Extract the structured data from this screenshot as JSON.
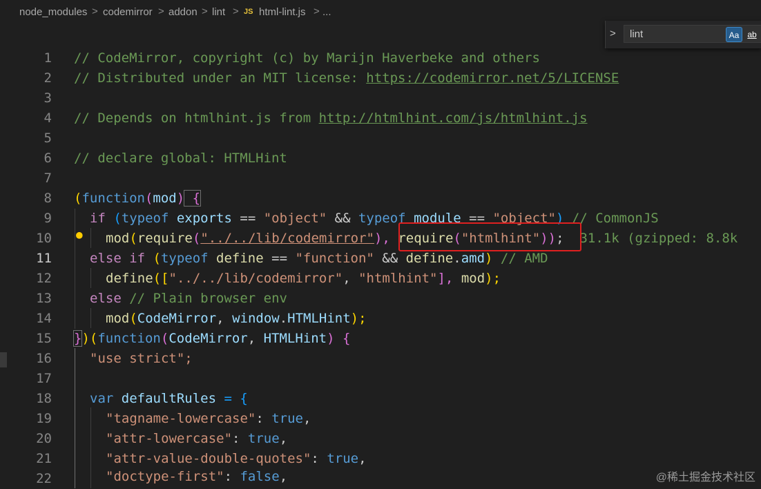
{
  "breadcrumb": {
    "items": [
      "node_modules",
      "codemirror",
      "addon",
      "lint",
      "html-lint.js",
      "..."
    ],
    "file_badge": "JS",
    "separator": ">"
  },
  "find": {
    "query": "lint",
    "match_case_label": "Aa",
    "whole_word_label": "ab"
  },
  "line_numbers": [
    "1",
    "2",
    "3",
    "4",
    "5",
    "6",
    "7",
    "8",
    "9",
    "10",
    "11",
    "12",
    "13",
    "14",
    "15",
    "16",
    "17",
    "18",
    "19",
    "20",
    "21",
    "22"
  ],
  "current_line": "11",
  "code": {
    "l1": "// CodeMirror, copyright (c) by Marijn Haverbeke and others",
    "l2a": "// Distributed under an MIT license: ",
    "l2b": "https://codemirror.net/5/LICENSE",
    "l4a": "// Depends on htmlhint.js from ",
    "l4b": "http://htmlhint.com/js/htmlhint.js",
    "l6": "// declare global: HTMLHint",
    "l8": [
      "(",
      "function",
      "(",
      "mod",
      ")",
      " {"
    ],
    "l9": [
      "if",
      " (",
      "typeof",
      " exports",
      " == ",
      "\"object\"",
      " && ",
      "typeof",
      " module",
      " == ",
      "\"object\"",
      ")",
      " // CommonJS"
    ],
    "l10": [
      "mod",
      "(",
      "require",
      "(",
      "\"../../lib/codemirror\"",
      "),",
      " require",
      "(",
      "\"htmlhint\"",
      "))",
      ";"
    ],
    "l10_inlay": "31.1k (gzipped: 8.8k",
    "l11": [
      "else if",
      " (",
      "typeof",
      " define",
      " == ",
      "\"function\"",
      " && ",
      "define",
      ".",
      "amd",
      ")",
      " // AMD"
    ],
    "l12": [
      "define",
      "([",
      "\"../../lib/codemirror\"",
      ", ",
      "\"htmlhint\"",
      "], ",
      "mod",
      ");"
    ],
    "l13": [
      "else",
      " // Plain browser env"
    ],
    "l14": [
      "mod",
      "(",
      "CodeMirror",
      ", ",
      "window",
      ".",
      "HTMLHint",
      ");"
    ],
    "l15": [
      "}",
      ")(",
      "function",
      "(",
      "CodeMirror",
      ", ",
      "HTMLHint",
      ") {"
    ],
    "l16": "\"use strict\";",
    "l18": [
      "var",
      " defaultRules",
      " = {"
    ],
    "l19": [
      "\"tagname-lowercase\"",
      ": ",
      "true",
      ","
    ],
    "l20": [
      "\"attr-lowercase\"",
      ": ",
      "true",
      ","
    ],
    "l21": [
      "\"attr-value-double-quotes\"",
      ": ",
      "true",
      ","
    ],
    "l22": [
      "\"doctype-first\"",
      ": ",
      "false",
      ","
    ]
  },
  "watermark": "@稀土掘金技术社区",
  "colors": {
    "background": "#1f1f1f",
    "comment": "#6a9955",
    "keyword": "#569cd6",
    "control": "#c586c0",
    "string": "#ce9178",
    "function": "#dcdcaa",
    "variable": "#9cdcfe",
    "highlight_box": "#e02020"
  }
}
